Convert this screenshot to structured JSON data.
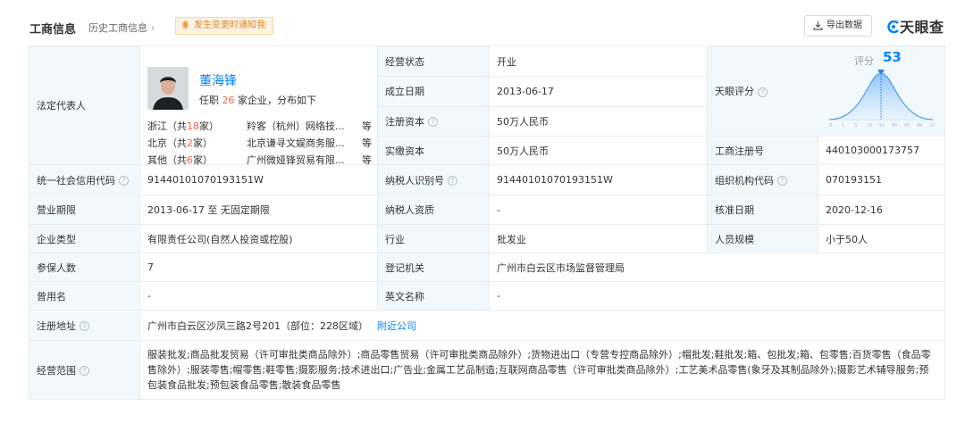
{
  "header": {
    "title": "工商信息",
    "history_link": "历史工商信息",
    "notify_label": "发生变更时通知我",
    "export_label": "导出数据",
    "brand": "天眼查"
  },
  "rep": {
    "label": "法定代表人",
    "name": "董海锋",
    "sub_prefix": "任职",
    "sub_count": "26",
    "sub_suffix": "家企业，分布如下",
    "rows": [
      {
        "region": "浙江（共",
        "count": "18",
        "unit": "家）",
        "company": "羚客（杭州）网络技...",
        "more": "等"
      },
      {
        "region": "北京（共",
        "count": "2",
        "unit": "家）",
        "company": "北京谦寻文娱商务服...",
        "more": "等"
      },
      {
        "region": "其他（共",
        "count": "6",
        "unit": "家）",
        "company": "广州微娅锋贸易有限...",
        "more": "等"
      }
    ]
  },
  "fields": {
    "status_label": "经营状态",
    "status_value": "开业",
    "founded_label": "成立日期",
    "founded_value": "2013-06-17",
    "capital_label": "注册资本",
    "capital_value": "50万人民币",
    "paid_label": "实缴资本",
    "paid_value": "50万人民币",
    "score_label": "天眼评分",
    "score_title": "评分",
    "score_value": "53",
    "score_ticks": [
      "0",
      "1",
      "3",
      "15",
      "50",
      "85",
      "97",
      "99",
      "100"
    ],
    "regno_label": "工商注册号",
    "regno_value": "440103000173757",
    "credit_label": "统一社会信用代码",
    "credit_value": "91440101070193151W",
    "tax_label": "纳税人识别号",
    "tax_value": "91440101070193151W",
    "org_label": "组织机构代码",
    "org_value": "070193151",
    "term_label": "营业期限",
    "term_value": "2013-06-17  至 无固定期限",
    "taxq_label": "纳税人资质",
    "taxq_value": "-",
    "approve_label": "核准日期",
    "approve_value": "2020-12-16",
    "type_label": "企业类型",
    "type_value": "有限责任公司(自然人投资或控股)",
    "industry_label": "行业",
    "industry_value": "批发业",
    "staff_label": "人员规模",
    "staff_value": "小于50人",
    "insured_label": "参保人数",
    "insured_value": "7",
    "authority_label": "登记机关",
    "authority_value": "广州市白云区市场监督管理局",
    "former_label": "曾用名",
    "former_value": "-",
    "english_label": "英文名称",
    "english_value": "-",
    "address_label": "注册地址",
    "address_value": "广州市白云区沙凤三路2号201（部位：228区域）",
    "address_link": "附近公司",
    "scope_label": "经营范围",
    "scope_value": "服装批发;商品批发贸易（许可审批类商品除外）;商品零售贸易（许可审批类商品除外）;货物进出口（专营专控商品除外）;帽批发;鞋批发;箱、包批发;箱、包零售;百货零售（食品零售除外）;服装零售;帽零售;鞋零售;摄影服务;技术进出口;广告业;金属工艺品制造;互联网商品零售（许可审批类商品除外）;工艺美术品零售(象牙及其制品除外);摄影艺术辅导服务;预包装食品批发;预包装食品零售;散装食品零售"
  },
  "colors": {
    "accent": "#0084ff",
    "count_red": "#ff5e45",
    "label_bg": "#f2f9fc"
  }
}
